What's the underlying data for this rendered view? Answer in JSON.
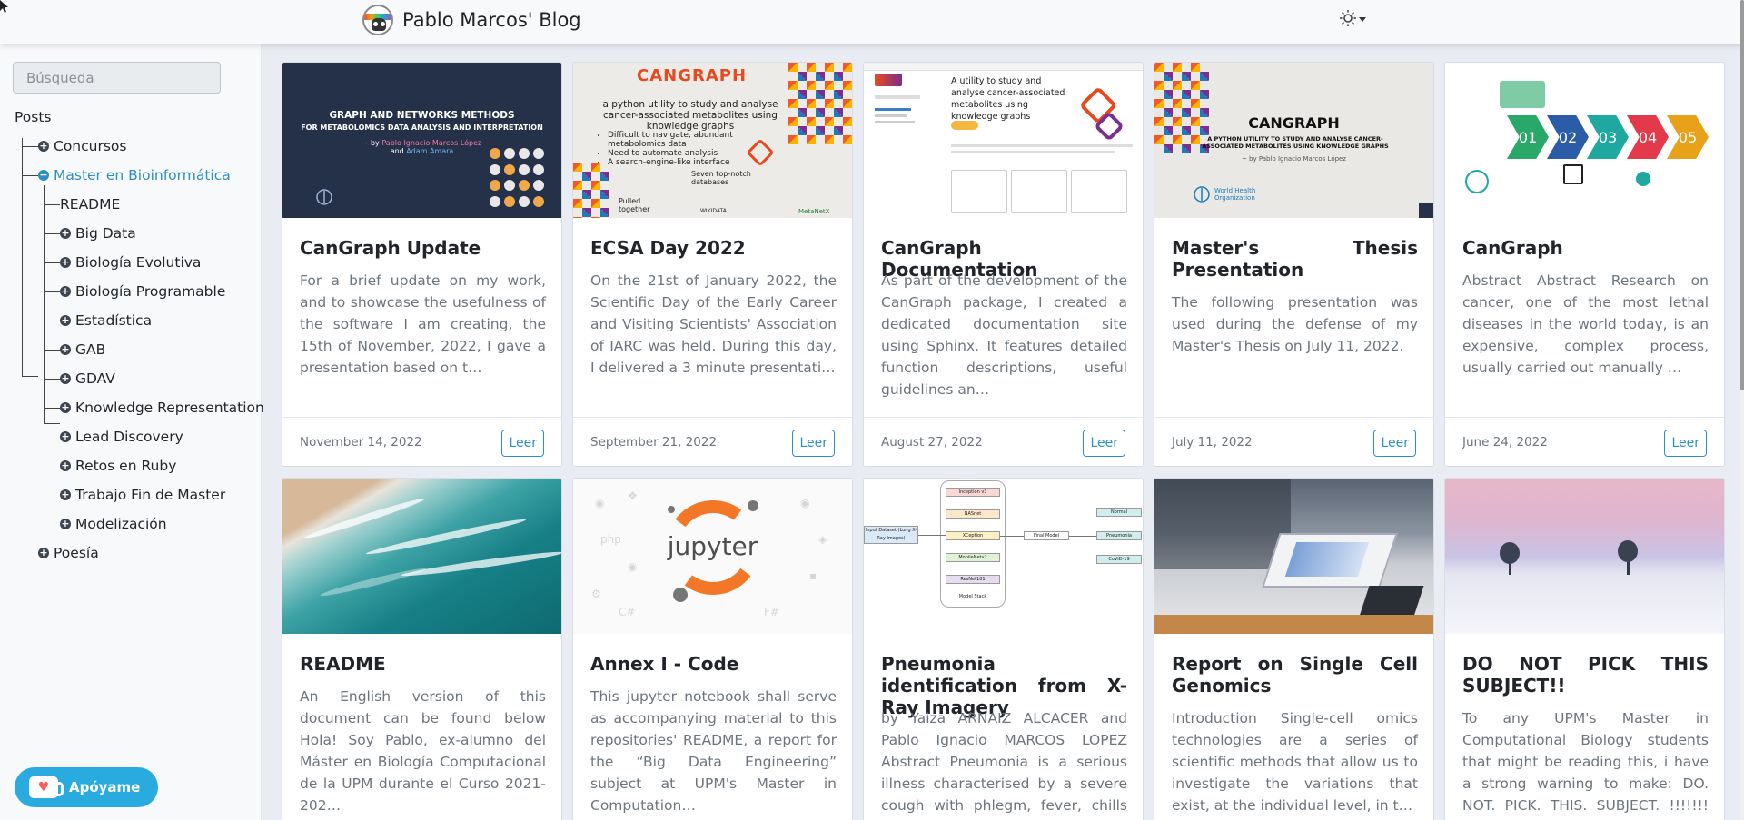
{
  "navbar": {
    "brand_title": "Pablo Marcos' Blog",
    "theme_icon": "sun-icon"
  },
  "sidebar": {
    "search_placeholder": "Búsqueda",
    "section_title": "Posts",
    "tree": [
      {
        "label": "Concursos",
        "level": 1,
        "toggle": "+"
      },
      {
        "label": "Master en Bioinformática",
        "level": 1,
        "toggle": "−",
        "active": true
      },
      {
        "label": "README",
        "level": 2
      },
      {
        "label": "Big Data",
        "level": 2,
        "toggle": "+"
      },
      {
        "label": "Biología Evolutiva",
        "level": 2,
        "toggle": "+"
      },
      {
        "label": "Biología Programable",
        "level": 2,
        "toggle": "+"
      },
      {
        "label": "Estadística",
        "level": 2,
        "toggle": "+"
      },
      {
        "label": "GAB",
        "level": 2,
        "toggle": "+"
      },
      {
        "label": "GDAV",
        "level": 2,
        "toggle": "+"
      },
      {
        "label": "Knowledge Representation",
        "level": 2,
        "toggle": "+"
      },
      {
        "label": "Lead Discovery",
        "level": 2,
        "toggle": "+"
      },
      {
        "label": "Retos en Ruby",
        "level": 2,
        "toggle": "+"
      },
      {
        "label": "Trabajo Fin de Master",
        "level": 2,
        "toggle": "+"
      },
      {
        "label": "Modelización",
        "level": 2,
        "toggle": "+"
      },
      {
        "label": "Poesía",
        "level": 1,
        "toggle": "+"
      }
    ],
    "support_label": "Apóyame"
  },
  "read_label": "Leer",
  "cards": [
    {
      "title": "CanGraph Update",
      "excerpt": "For a brief update on my work, and to showcase the usefulness of the software I am creating, the 15th of November, 2022, I gave a presentation based on t…",
      "date": "November 14, 2022"
    },
    {
      "title": "ECSA Day 2022",
      "excerpt": "On the 21st of January 2022, the Scientific Day of the Early Career and Visiting Scientists' Association of IARC was held. During this day, I delivered a 3 minute presentati…",
      "date": "September 21, 2022"
    },
    {
      "title": "CanGraph Documentation",
      "excerpt": "As part of the development of the CanGraph package, I created a dedicated documentation site using Sphinx. It features detailed function descriptions, useful guidelines an…",
      "date": "August 27, 2022"
    },
    {
      "title": "Master's Thesis Presentation",
      "excerpt": "The following presentation was used during the defense of my Master's Thesis on July 11, 2022.",
      "date": "July 11, 2022"
    },
    {
      "title": "CanGraph",
      "excerpt": "Abstract Abstract Research on cancer, one of the most lethal diseases in the world today, is an expensive, complex process, usually carried out manually …",
      "date": "June 24, 2022"
    },
    {
      "title": "README",
      "excerpt": "An English version of this document can be found below Hola! Soy Pablo, ex-alumno del Máster en Biología Computacional de la UPM durante el Curso 2021-202…"
    },
    {
      "title": "Annex I - Code",
      "excerpt": "This jupyter notebook shall serve as accompanying material to this repositories' README, a report for the “Big Data Engineering” subject at UPM's Master in Computation…"
    },
    {
      "title": "Pneumonia identification from X-Ray Imagery",
      "excerpt": "by Yaiza ARNAIZ ALCACER and Pablo Ignacio MARCOS LOPEZ Abstract Pneumonia is a serious illness characterised by a severe cough with phlegm, fever, chills a…"
    },
    {
      "title": "Report on Single Cell Genomics",
      "excerpt": "Introduction Single-cell omics technologies are a series of scientific methods that allow us to investigate the variations that exist, at the individual level, in t…"
    },
    {
      "title": "DO NOT PICK THIS SUBJECT!!",
      "excerpt": "To any UPM's Master in Computational Biology students that might be reading this, i have a strong warning to make: DO. NOT. PICK. THIS. SUBJECT. !!!!!!! T…"
    }
  ],
  "thumbs": {
    "graph_methods": {
      "line1": "GRAPH AND NETWORKS METHODS",
      "line2": "FOR METABOLOMICS DATA ANALYSIS AND INTERPRETATION",
      "by": "~ by",
      "author1": "Pablo Ignacio Marcos López",
      "and": "and",
      "author2": "Adam Amara"
    },
    "ecsa": {
      "logo": "CANGRAPH",
      "subtitle": "a python utility to study and analyse cancer-associated metabolites using knowledge graphs",
      "bullets": [
        "Difficult to navigate, abundant metabolomics data",
        "Need to automate analysis",
        "A search-engine-like interface"
      ],
      "seven": "Seven top-notch databases",
      "pulled": "Pulled together",
      "wikidata": "WIKIDATA",
      "metanetx": "MetaNetX"
    },
    "doc": {
      "heading": "A utility to study and analyse cancer-associated metabolites using knowledge graphs"
    },
    "thesis": {
      "title": "CANGRAPH",
      "subtitle": "A PYTHON UTILITY TO STUDY AND ANALYSE CANCER-ASSOCIATED METABOLITES USING KNOWLEDGE GRAPHS",
      "by": "~ by Pablo Ignacio Marcos López",
      "org": "World Health Organization"
    },
    "steps": [
      "01",
      "02",
      "03",
      "04",
      "05"
    ],
    "jupyter": {
      "word": "jupyter"
    },
    "diagram": {
      "input": "Input Dataset (Lung X-Ray Images)",
      "models": [
        "Inception v3",
        "NASnet",
        "XCeption",
        "MobileNetv2",
        "ResNet101"
      ],
      "stack": "Model Stack",
      "final": "Final Model",
      "classes": [
        "Normal",
        "Pneumonia",
        "CoViD-19"
      ]
    }
  },
  "colors": {
    "accent": "#2a8fc7",
    "support": "#29abe0",
    "background": "#e9ecf2"
  }
}
